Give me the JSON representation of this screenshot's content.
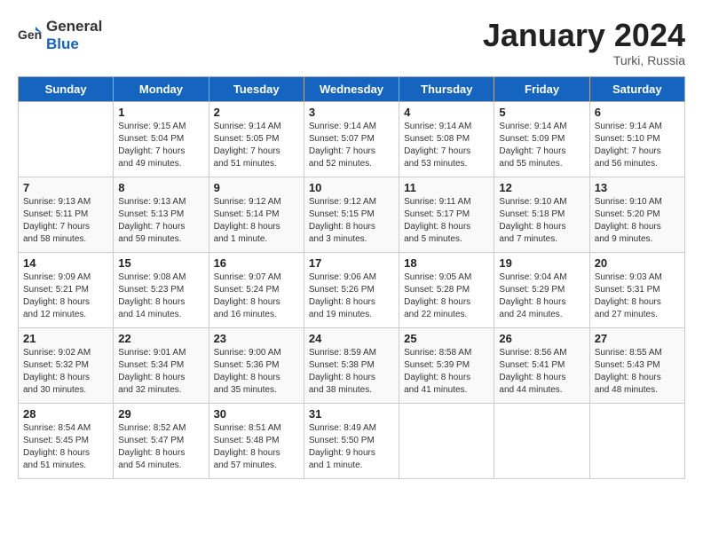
{
  "header": {
    "logo_general": "General",
    "logo_blue": "Blue",
    "month_title": "January 2024",
    "subtitle": "Turki, Russia"
  },
  "days_of_week": [
    "Sunday",
    "Monday",
    "Tuesday",
    "Wednesday",
    "Thursday",
    "Friday",
    "Saturday"
  ],
  "weeks": [
    [
      {
        "day": "",
        "info": ""
      },
      {
        "day": "1",
        "info": "Sunrise: 9:15 AM\nSunset: 5:04 PM\nDaylight: 7 hours\nand 49 minutes."
      },
      {
        "day": "2",
        "info": "Sunrise: 9:14 AM\nSunset: 5:05 PM\nDaylight: 7 hours\nand 51 minutes."
      },
      {
        "day": "3",
        "info": "Sunrise: 9:14 AM\nSunset: 5:07 PM\nDaylight: 7 hours\nand 52 minutes."
      },
      {
        "day": "4",
        "info": "Sunrise: 9:14 AM\nSunset: 5:08 PM\nDaylight: 7 hours\nand 53 minutes."
      },
      {
        "day": "5",
        "info": "Sunrise: 9:14 AM\nSunset: 5:09 PM\nDaylight: 7 hours\nand 55 minutes."
      },
      {
        "day": "6",
        "info": "Sunrise: 9:14 AM\nSunset: 5:10 PM\nDaylight: 7 hours\nand 56 minutes."
      }
    ],
    [
      {
        "day": "7",
        "info": "Sunrise: 9:13 AM\nSunset: 5:11 PM\nDaylight: 7 hours\nand 58 minutes."
      },
      {
        "day": "8",
        "info": "Sunrise: 9:13 AM\nSunset: 5:13 PM\nDaylight: 7 hours\nand 59 minutes."
      },
      {
        "day": "9",
        "info": "Sunrise: 9:12 AM\nSunset: 5:14 PM\nDaylight: 8 hours\nand 1 minute."
      },
      {
        "day": "10",
        "info": "Sunrise: 9:12 AM\nSunset: 5:15 PM\nDaylight: 8 hours\nand 3 minutes."
      },
      {
        "day": "11",
        "info": "Sunrise: 9:11 AM\nSunset: 5:17 PM\nDaylight: 8 hours\nand 5 minutes."
      },
      {
        "day": "12",
        "info": "Sunrise: 9:10 AM\nSunset: 5:18 PM\nDaylight: 8 hours\nand 7 minutes."
      },
      {
        "day": "13",
        "info": "Sunrise: 9:10 AM\nSunset: 5:20 PM\nDaylight: 8 hours\nand 9 minutes."
      }
    ],
    [
      {
        "day": "14",
        "info": "Sunrise: 9:09 AM\nSunset: 5:21 PM\nDaylight: 8 hours\nand 12 minutes."
      },
      {
        "day": "15",
        "info": "Sunrise: 9:08 AM\nSunset: 5:23 PM\nDaylight: 8 hours\nand 14 minutes."
      },
      {
        "day": "16",
        "info": "Sunrise: 9:07 AM\nSunset: 5:24 PM\nDaylight: 8 hours\nand 16 minutes."
      },
      {
        "day": "17",
        "info": "Sunrise: 9:06 AM\nSunset: 5:26 PM\nDaylight: 8 hours\nand 19 minutes."
      },
      {
        "day": "18",
        "info": "Sunrise: 9:05 AM\nSunset: 5:28 PM\nDaylight: 8 hours\nand 22 minutes."
      },
      {
        "day": "19",
        "info": "Sunrise: 9:04 AM\nSunset: 5:29 PM\nDaylight: 8 hours\nand 24 minutes."
      },
      {
        "day": "20",
        "info": "Sunrise: 9:03 AM\nSunset: 5:31 PM\nDaylight: 8 hours\nand 27 minutes."
      }
    ],
    [
      {
        "day": "21",
        "info": "Sunrise: 9:02 AM\nSunset: 5:32 PM\nDaylight: 8 hours\nand 30 minutes."
      },
      {
        "day": "22",
        "info": "Sunrise: 9:01 AM\nSunset: 5:34 PM\nDaylight: 8 hours\nand 32 minutes."
      },
      {
        "day": "23",
        "info": "Sunrise: 9:00 AM\nSunset: 5:36 PM\nDaylight: 8 hours\nand 35 minutes."
      },
      {
        "day": "24",
        "info": "Sunrise: 8:59 AM\nSunset: 5:38 PM\nDaylight: 8 hours\nand 38 minutes."
      },
      {
        "day": "25",
        "info": "Sunrise: 8:58 AM\nSunset: 5:39 PM\nDaylight: 8 hours\nand 41 minutes."
      },
      {
        "day": "26",
        "info": "Sunrise: 8:56 AM\nSunset: 5:41 PM\nDaylight: 8 hours\nand 44 minutes."
      },
      {
        "day": "27",
        "info": "Sunrise: 8:55 AM\nSunset: 5:43 PM\nDaylight: 8 hours\nand 48 minutes."
      }
    ],
    [
      {
        "day": "28",
        "info": "Sunrise: 8:54 AM\nSunset: 5:45 PM\nDaylight: 8 hours\nand 51 minutes."
      },
      {
        "day": "29",
        "info": "Sunrise: 8:52 AM\nSunset: 5:47 PM\nDaylight: 8 hours\nand 54 minutes."
      },
      {
        "day": "30",
        "info": "Sunrise: 8:51 AM\nSunset: 5:48 PM\nDaylight: 8 hours\nand 57 minutes."
      },
      {
        "day": "31",
        "info": "Sunrise: 8:49 AM\nSunset: 5:50 PM\nDaylight: 9 hours\nand 1 minute."
      },
      {
        "day": "",
        "info": ""
      },
      {
        "day": "",
        "info": ""
      },
      {
        "day": "",
        "info": ""
      }
    ]
  ]
}
